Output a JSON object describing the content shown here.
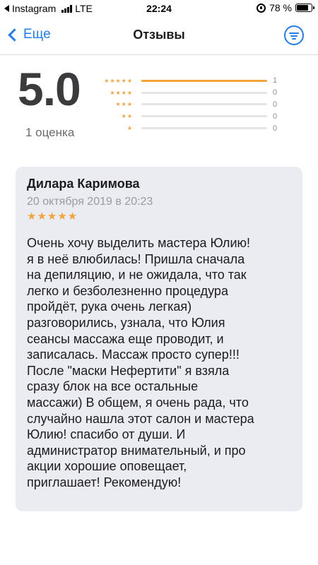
{
  "status_bar": {
    "back_app": "Instagram",
    "network": "LTE",
    "time": "22:24",
    "battery": "78 %",
    "battery_level": 0.78
  },
  "nav": {
    "back_label": "Еще",
    "title": "Отзывы",
    "filter_icon": "filter-icon"
  },
  "summary": {
    "score": "5.0",
    "count_label": "1 оценка",
    "rows": [
      {
        "stars": "★★★★★",
        "count": "1",
        "fraction": 1.0
      },
      {
        "stars": "★★★★",
        "count": "0",
        "fraction": 0
      },
      {
        "stars": "★★★",
        "count": "0",
        "fraction": 0
      },
      {
        "stars": "★★",
        "count": "0",
        "fraction": 0
      },
      {
        "stars": "★",
        "count": "0",
        "fraction": 0
      }
    ]
  },
  "review": {
    "author": "Дилара Каримова",
    "date": "20 октября 2019 в 20:23",
    "stars": "★★★★★",
    "rating": 5,
    "text": "Очень хочу выделить мастера Юлию!\nя в неё влюбилась! Пришла сначала\nна депиляцию, и не ожидала, что так\nлегко и безболезненно процедура\nпройдёт, рука очень легкая)\nразговорились, узнала, что Юлия\nсеансы массажа еще проводит, и\nзаписалась. Массаж просто супер!!!\nПосле \"маски Нефертити\" я взяла\nсразу блок на все остальные\nмассажи) В общем,  я очень рада, что\nслучайно нашла этот салон и мастера\nЮлию! спасибо от души. И\nадминистратор внимательный, и про\nакции  хорошие оповещает,\nприглашает! Рекомендую!"
  },
  "colors": {
    "accent": "#1f7ff0",
    "star": "#f2a33a",
    "card_bg": "#ebebf2"
  }
}
